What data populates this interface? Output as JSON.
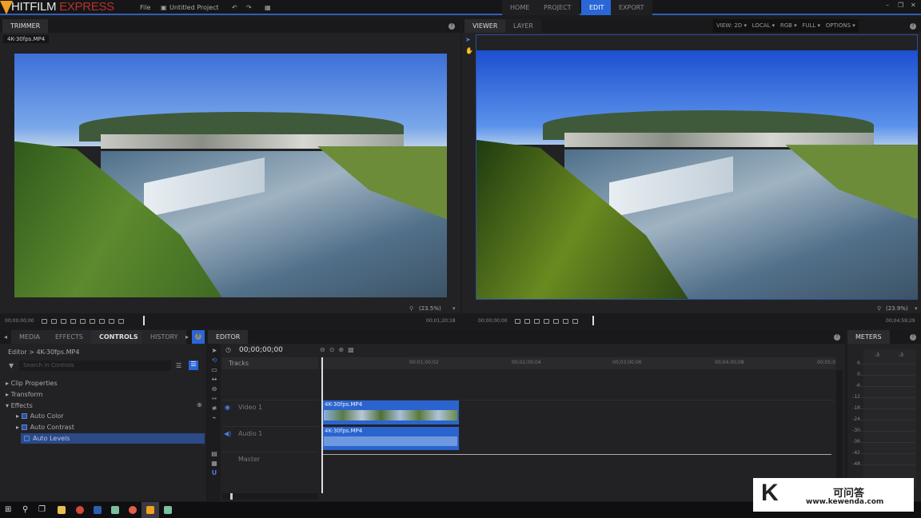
{
  "app": {
    "logo_primary": "HITFILM",
    "logo_secondary": "EXPRESS",
    "menu_file": "File",
    "project_name": "Untitled Project"
  },
  "nav": {
    "tabs": [
      {
        "label": "HOME"
      },
      {
        "label": "PROJECT"
      },
      {
        "label": "EDIT",
        "active": true
      },
      {
        "label": "EXPORT"
      }
    ]
  },
  "trimmer": {
    "title": "TRIMMER",
    "clip_tab": "4K-30fps.MP4",
    "zoom": "(23.5%)",
    "time_start": "00;00;00;00",
    "time_end": "00;01;20;18"
  },
  "viewer": {
    "tabs": [
      "VIEWER",
      "LAYER"
    ],
    "dropdowns": [
      "VIEW: 2D",
      "LOCAL",
      "RGB",
      "FULL",
      "OPTIONS"
    ],
    "zoom": "(23.9%)",
    "time_start": "00;00;00;00",
    "time_end": "00;04;59;29"
  },
  "left_panel": {
    "tabs": [
      "MEDIA",
      "EFFECTS",
      "CONTROLS",
      "HISTORY"
    ],
    "active_tab": "CONTROLS",
    "breadcrumb": "Editor > 4K-30fps.MP4",
    "search_placeholder": "Search in Controls",
    "tree": [
      {
        "label": "Clip Properties"
      },
      {
        "label": "Transform"
      },
      {
        "label": "Effects",
        "expanded": true
      }
    ],
    "effects": [
      {
        "label": "Auto Color",
        "checked": true
      },
      {
        "label": "Auto Contrast",
        "checked": true
      },
      {
        "label": "Auto Levels",
        "checked": true,
        "selected": true
      }
    ]
  },
  "editor": {
    "title": "EDITOR",
    "timecode": "00;00;00;00",
    "tracks_label": "Tracks",
    "ruler": [
      "00;01;00;02",
      "00;02;00;04",
      "00;03;00;06",
      "00;04;00;08",
      "00;05;0"
    ],
    "tracks": [
      {
        "name": "Video 1",
        "clip": "4K-30fps.MP4"
      },
      {
        "name": "Audio 1",
        "clip": "4K-30fps.MP4"
      },
      {
        "name": "Master"
      }
    ]
  },
  "meters": {
    "title": "METERS",
    "channels": [
      "-3",
      "-3"
    ],
    "scale": [
      "6",
      "0",
      "-6",
      "-12",
      "-18",
      "-24",
      "-30",
      "-36",
      "-42",
      "-48"
    ]
  },
  "watermark": {
    "brand": "可问答",
    "url": "www.kewenda.com",
    "letter": "K"
  },
  "colors": {
    "accent": "#2a66d6",
    "clip": "#2b64cf",
    "logo_orange": "#f2a020",
    "logo_red": "#b8322a"
  }
}
